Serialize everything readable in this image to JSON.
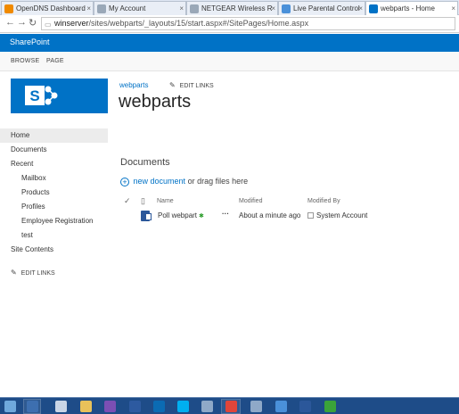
{
  "browser": {
    "tabs": [
      {
        "label": "OpenDNS Dashboard",
        "icon": "opendns-icon",
        "color": "#f08a00"
      },
      {
        "label": "My Account",
        "icon": "page-icon",
        "color": "#9aa8b8"
      },
      {
        "label": "NETGEAR Wireless R",
        "icon": "page-icon",
        "color": "#9aa8b8"
      },
      {
        "label": "Live Parental Control",
        "icon": "live-icon",
        "color": "#4a90d9"
      },
      {
        "label": "webparts - Home",
        "icon": "sharepoint-icon",
        "color": "#0072c6"
      }
    ],
    "url_host": "winserver",
    "url_path": "/sites/webparts/_layouts/15/start.aspx#/SitePages/Home.aspx"
  },
  "suite_bar": {
    "title": "SharePoint",
    "color": "#0072c6"
  },
  "ribbon": {
    "tabs": [
      "BROWSE",
      "PAGE"
    ]
  },
  "site": {
    "breadcrumb": "webparts",
    "edit_links": "EDIT LINKS",
    "title": "webparts",
    "logo_color": "#0072c6"
  },
  "left_nav": {
    "items": [
      {
        "label": "Home",
        "selected": true,
        "sub": false
      },
      {
        "label": "Documents",
        "selected": false,
        "sub": false
      },
      {
        "label": "Recent",
        "selected": false,
        "sub": false
      },
      {
        "label": "Mailbox",
        "selected": false,
        "sub": true
      },
      {
        "label": "Products",
        "selected": false,
        "sub": true
      },
      {
        "label": "Profiles",
        "selected": false,
        "sub": true
      },
      {
        "label": "Employee Registration",
        "selected": false,
        "sub": true
      },
      {
        "label": "test",
        "selected": false,
        "sub": true
      },
      {
        "label": "Site Contents",
        "selected": false,
        "sub": false
      }
    ],
    "edit_links": "EDIT LINKS"
  },
  "documents": {
    "title": "Documents",
    "new_link": "new document",
    "new_suffix": "or drag files here",
    "columns": {
      "name": "Name",
      "modified": "Modified",
      "modified_by": "Modified By"
    },
    "rows": [
      {
        "name": "Poll webpart",
        "modified": "About a minute ago",
        "modified_by": "System Account"
      }
    ]
  },
  "taskbar": {
    "apps": [
      {
        "icon": "start-icon",
        "color": "#6fa8dc"
      },
      {
        "icon": "explorer-icon",
        "color": "#3d6fb0"
      },
      {
        "icon": "server-manager-icon",
        "color": "#c9d5e6"
      },
      {
        "icon": "folder-icon",
        "color": "#e8c15a"
      },
      {
        "icon": "visual-studio-icon",
        "color": "#7b4fb4"
      },
      {
        "icon": "powershell-icon",
        "color": "#2d5aa0"
      },
      {
        "icon": "sharepoint-taskbar-icon",
        "color": "#0b6bb3"
      },
      {
        "icon": "skype-icon",
        "color": "#00aff0"
      },
      {
        "icon": "settings-icon",
        "color": "#8fa9c8"
      },
      {
        "icon": "chrome-icon",
        "color": "#e0453a"
      },
      {
        "icon": "network-icon",
        "color": "#8fa9c8"
      },
      {
        "icon": "remote-desktop-icon",
        "color": "#4a90d9"
      },
      {
        "icon": "word-icon",
        "color": "#2b579a"
      },
      {
        "icon": "download-icon",
        "color": "#3aa33a"
      }
    ]
  }
}
